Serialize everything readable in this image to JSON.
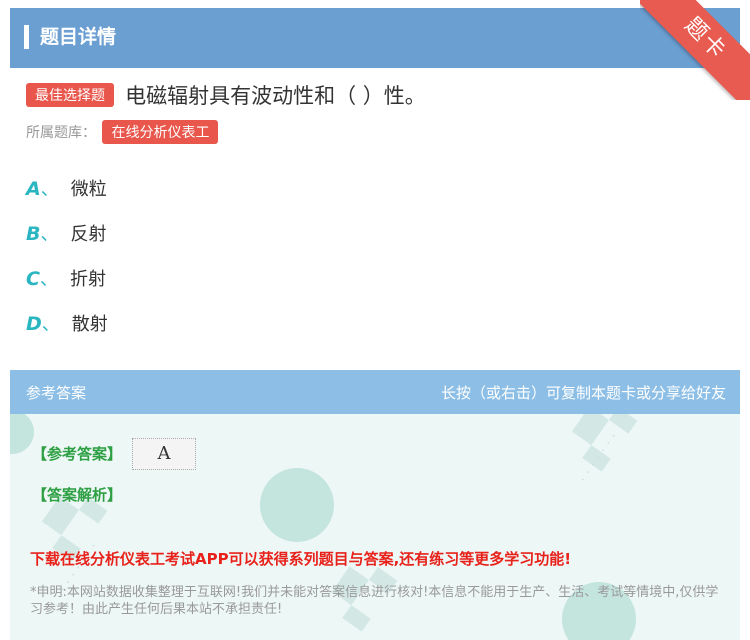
{
  "header": {
    "title": "题目详情",
    "ribbon_label": "题卡"
  },
  "question": {
    "type_badge": "最佳选择题",
    "text": "电磁辐射具有波动性和（ ）性。",
    "library_label": "所属题库：",
    "library_name": "在线分析仪表工"
  },
  "options": [
    {
      "letter": "A",
      "sep": "、",
      "text": "微粒"
    },
    {
      "letter": "B",
      "sep": "、",
      "text": "反射"
    },
    {
      "letter": "C",
      "sep": "、",
      "text": "折射"
    },
    {
      "letter": "D",
      "sep": "、",
      "text": "散射"
    }
  ],
  "answer": {
    "header_left": "参考答案",
    "header_right": "长按（或右击）可复制本题卡或分享给好友",
    "ref_label": "【参考答案】",
    "ref_value": "A",
    "analysis_label": "【答案解析】",
    "promo": "下载在线分析仪表工考试APP可以获得系列题目与答案,还有练习等更多学习功能!",
    "disclaimer": "*申明:本网站数据收集整理于互联网!我们并未能对答案信息进行核对!本信息不能用于生产、生活、考试等情境中,仅供学习参考！由此产生任何后果本站不承担责任!"
  },
  "colors": {
    "header_bg": "#6b9fd2",
    "badge_red": "#e8564c",
    "option_letter": "#29b6c0",
    "answer_header": "#8dbfe6",
    "answer_green": "#2ea043",
    "promo_red": "#e8221b"
  }
}
